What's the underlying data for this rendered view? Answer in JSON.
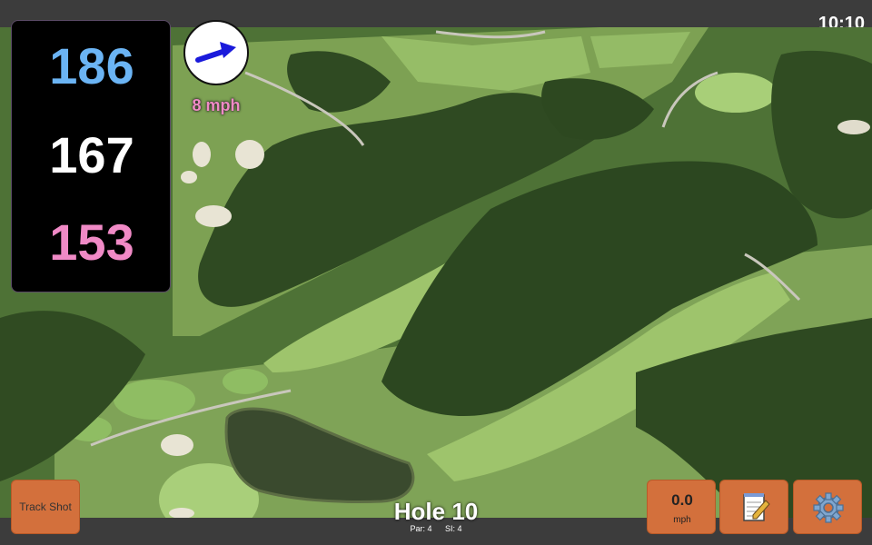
{
  "status_bar": {
    "time": "10:10"
  },
  "distances": {
    "back": "186",
    "middle": "167",
    "front": "153"
  },
  "wind": {
    "speed_label": "8 mph",
    "icon": "wind-direction-arrow-icon",
    "direction": "east-northeast"
  },
  "buttons": {
    "track_shot": "Track Shot",
    "speed_value": "0.0",
    "speed_unit": "mph",
    "notes_icon": "notepad-icon",
    "settings_icon": "gear-icon"
  },
  "hole": {
    "title": "Hole 10",
    "par": "Par: 4",
    "stroke_index": "SI: 4"
  },
  "colors": {
    "back": "#6bb4f4",
    "middle": "#ffffff",
    "front": "#f08ac6",
    "button": "#d3703c"
  }
}
